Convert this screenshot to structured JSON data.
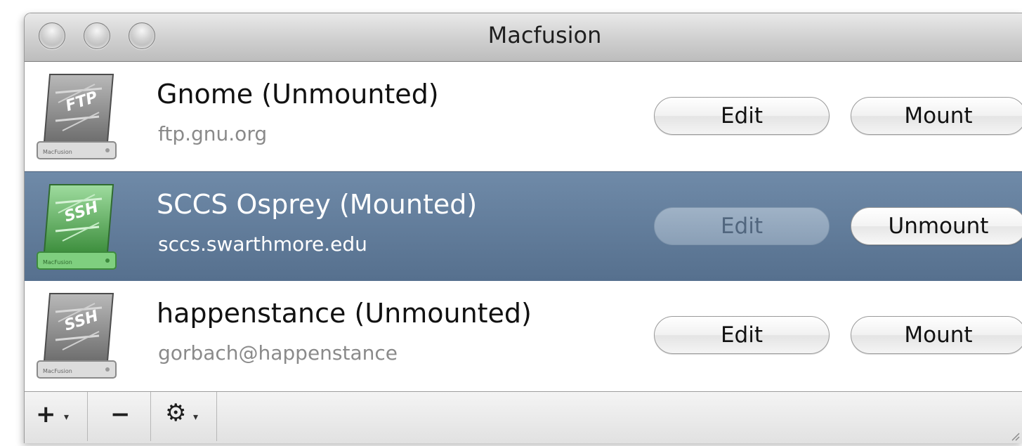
{
  "window": {
    "title": "Macfusion"
  },
  "mounts": [
    {
      "name": "Gnome (Unmounted)",
      "host": "ftp.gnu.org",
      "protocol_label": "FTP",
      "drive_footer": "MacFusion",
      "edit_label": "Edit",
      "action_label": "Mount",
      "selected": false,
      "drive_color": "#8a8a8a"
    },
    {
      "name": "SCCS Osprey (Mounted)",
      "host": "sccs.swarthmore.edu",
      "protocol_label": "SSH",
      "drive_footer": "MacFusion",
      "edit_label": "Edit",
      "action_label": "Unmount",
      "selected": true,
      "drive_color": "#5fae5f"
    },
    {
      "name": "happenstance (Unmounted)",
      "host": "gorbach@happenstance",
      "protocol_label": "SSH",
      "drive_footer": "MacFusion",
      "edit_label": "Edit",
      "action_label": "Mount",
      "selected": false,
      "drive_color": "#8a8a8a"
    }
  ],
  "toolbar": {
    "add_glyph": "+",
    "remove_glyph": "−",
    "gear_glyph": "⚙",
    "dropdown_glyph": "▾",
    "add_icon": "plus-icon",
    "remove_icon": "minus-icon",
    "action_icon": "gear-icon"
  },
  "colors": {
    "selection": "#5f7a98",
    "mounted_drive": "#5fae5f",
    "unmounted_drive": "#8a8a8a"
  }
}
